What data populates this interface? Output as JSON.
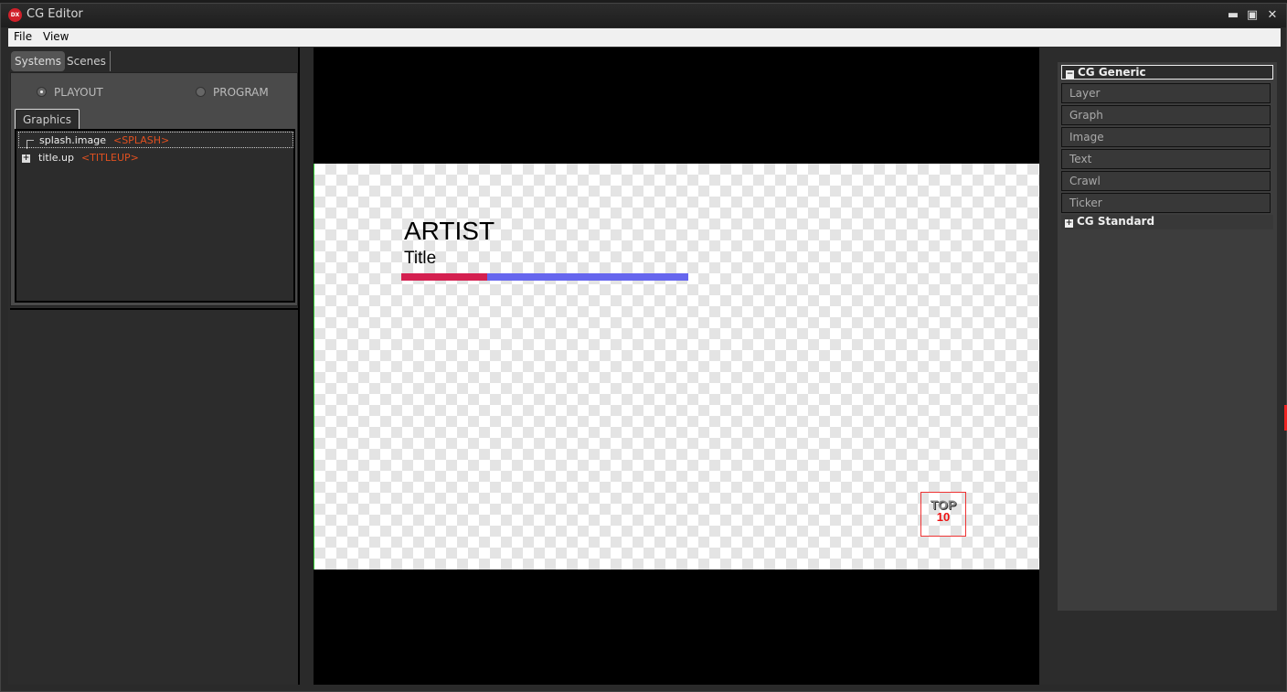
{
  "window": {
    "title": "CG Editor",
    "app_icon": "dx-logo-icon",
    "controls": [
      "minimize-icon",
      "maximize-icon",
      "close-icon"
    ]
  },
  "menu": {
    "items": [
      "File",
      "View"
    ]
  },
  "left_panel": {
    "tabs": [
      {
        "label": "Systems",
        "active": true
      },
      {
        "label": "Scenes",
        "active": false
      }
    ],
    "radios": [
      {
        "label": "PLAYOUT",
        "selected": true
      },
      {
        "label": "PROGRAM",
        "selected": false
      }
    ],
    "graphics_tab": "Graphics",
    "tree": [
      {
        "name": "splash.image",
        "tag": "<SPLASH>",
        "selected": true,
        "expandable": false
      },
      {
        "name": "title.up",
        "tag": "<TITLEUP>",
        "selected": false,
        "expandable": true
      }
    ]
  },
  "canvas": {
    "artist": "ARTIST",
    "title": "Title",
    "bar_colors": {
      "left": "#d42050",
      "right": "#6666ee"
    },
    "bar_split_fraction": 0.3,
    "logo": {
      "line1": "TOP",
      "line2": "10"
    }
  },
  "palette": {
    "groups": [
      {
        "label": "CG Generic",
        "expanded": true,
        "items": [
          "Layer",
          "Graph",
          "Image",
          "Text",
          "Crawl",
          "Ticker"
        ]
      },
      {
        "label": "CG Standard",
        "expanded": false,
        "items": []
      }
    ]
  }
}
